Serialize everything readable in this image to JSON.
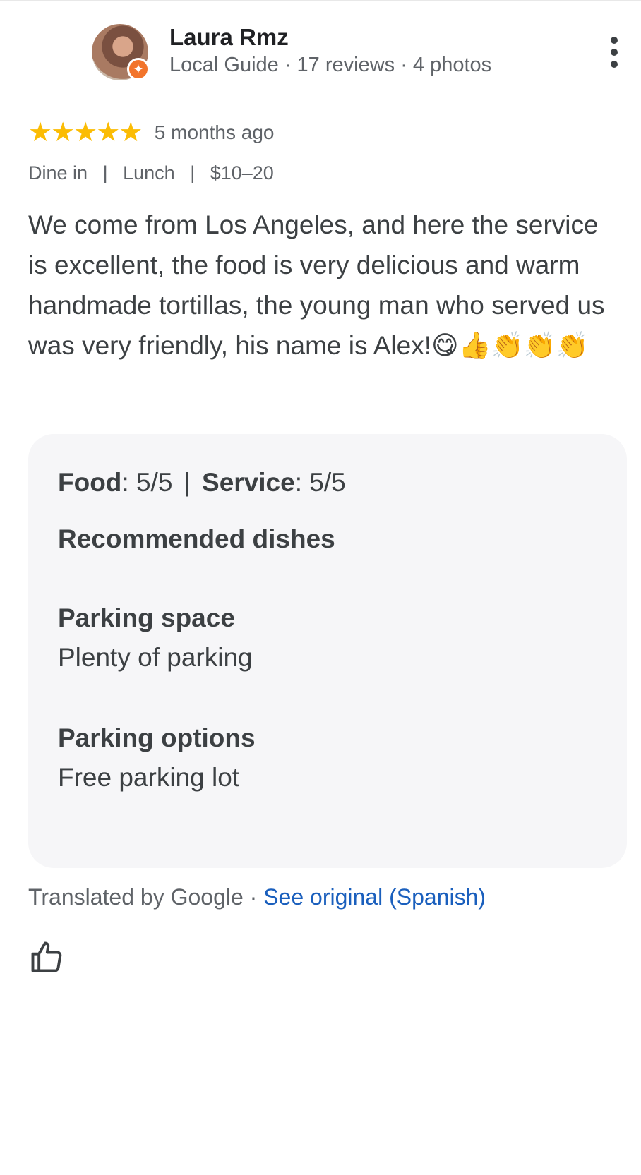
{
  "reviewer": {
    "name": "Laura Rmz",
    "meta": "Local Guide · 17 reviews · 4 photos",
    "avatar_icon": "avatar-photo",
    "badge_icon": "local-guide-badge-icon"
  },
  "rating": {
    "stars_text": "★★★★★",
    "value": 5,
    "max": 5,
    "time_ago": "5 months ago",
    "star_color": "#fbbc04"
  },
  "tags": [
    "Dine in",
    "Lunch",
    "$10–20"
  ],
  "review": {
    "text": "We come from Los Angeles, and here the service is excellent, the food is very delicious and warm handmade tortillas, the young man who served us was very friendly, his name is Alex!😋👍👏👏👏"
  },
  "details": {
    "food_label": "Food",
    "food_value": ": 5/5",
    "service_label": "Service",
    "service_value": ": 5/5",
    "recommended_heading": "Recommended dishes",
    "parking_space_heading": "Parking space",
    "parking_space_value": "Plenty of parking",
    "parking_options_heading": "Parking options",
    "parking_options_value": "Free parking lot"
  },
  "translation": {
    "note": "Translated by Google",
    "separator": " · ",
    "link": "See original (Spanish)",
    "link_color": "#1a5fbd"
  },
  "actions": {
    "like_icon": "thumbs-up-outline-icon",
    "more_icon": "more-vert-icon"
  }
}
